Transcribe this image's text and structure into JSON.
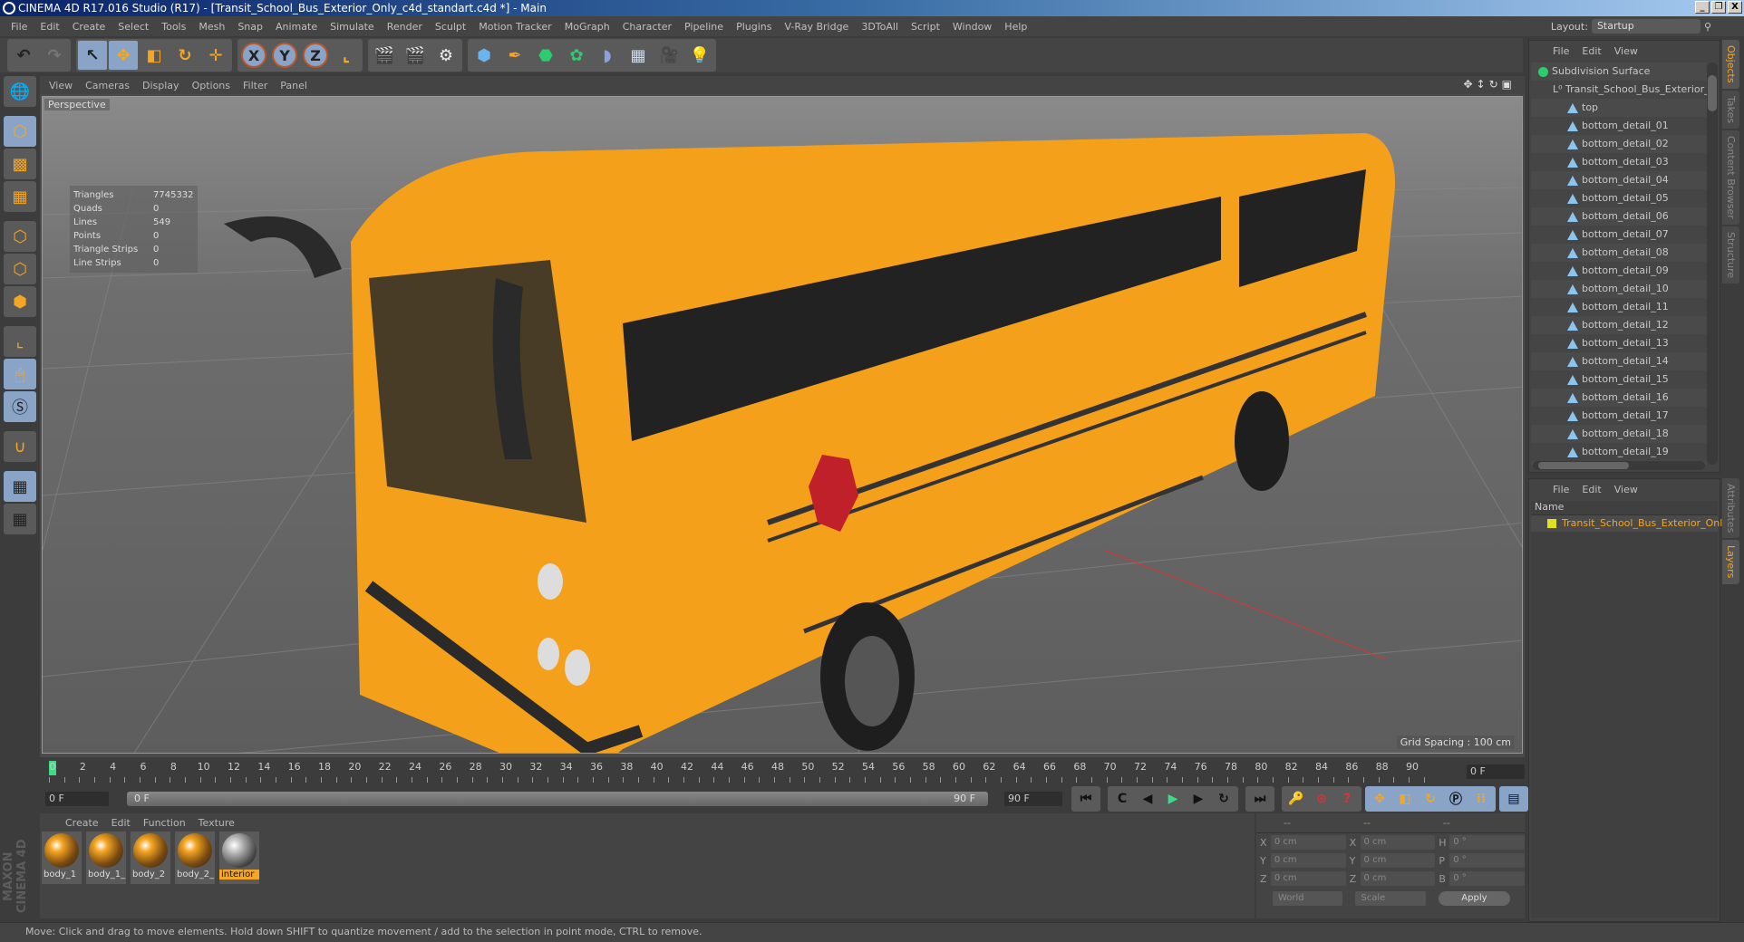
{
  "window": {
    "title": "CINEMA 4D R17.016 Studio (R17) - [Transit_School_Bus_Exterior_Only_c4d_standart.c4d *] - Main",
    "controls": [
      "_",
      "❐",
      "X"
    ]
  },
  "menu": [
    "File",
    "Edit",
    "Create",
    "Select",
    "Tools",
    "Mesh",
    "Snap",
    "Animate",
    "Simulate",
    "Render",
    "Sculpt",
    "Motion Tracker",
    "MoGraph",
    "Character",
    "Pipeline",
    "Plugins",
    "V-Ray Bridge",
    "3DToAll",
    "Script",
    "Window",
    "Help"
  ],
  "layout": {
    "label": "Layout:",
    "value": "Startup"
  },
  "toolbar": {
    "undo": "undo-icon",
    "redo": "redo-icon",
    "tools": [
      {
        "name": "live-selection",
        "glyph": "↖"
      },
      {
        "name": "move",
        "glyph": "✥"
      },
      {
        "name": "scale",
        "glyph": "◧"
      },
      {
        "name": "rotate",
        "glyph": "↻"
      },
      {
        "name": "recent-tool",
        "glyph": "✛"
      }
    ],
    "axes": [
      "X",
      "Y",
      "Z"
    ],
    "coord": "world-coordinate-icon",
    "render": [
      "render-view",
      "render-picture-viewer",
      "edit-render-settings"
    ],
    "objects": [
      "cube",
      "pen-spline",
      "subdivision",
      "cloner",
      "deformer",
      "floor",
      "camera",
      "light"
    ]
  },
  "left_tools": [
    "model-mode",
    "texture-mode",
    "workplane",
    "points-mode",
    "edges-mode",
    "polygons-mode",
    "axis",
    "tweak",
    "solo",
    "snap",
    "lock-workplane",
    "workplane-align"
  ],
  "viewport": {
    "menu": [
      "View",
      "Cameras",
      "Display",
      "Options",
      "Filter",
      "Panel"
    ],
    "camera": "Perspective",
    "stats": [
      {
        "k": "Triangles",
        "v": "7745332"
      },
      {
        "k": "Quads",
        "v": "0"
      },
      {
        "k": "Lines",
        "v": "549"
      },
      {
        "k": "Points",
        "v": "0"
      },
      {
        "k": "Triangle Strips",
        "v": "0"
      },
      {
        "k": "Line Strips",
        "v": "0"
      }
    ],
    "grid": "Grid Spacing : 100 cm",
    "bus_color": "#f5a01a"
  },
  "timeline": {
    "ticks": [
      "0",
      "2",
      "4",
      "6",
      "8",
      "10",
      "12",
      "14",
      "16",
      "18",
      "20",
      "22",
      "24",
      "26",
      "28",
      "30",
      "32",
      "34",
      "36",
      "38",
      "40",
      "42",
      "44",
      "46",
      "48",
      "50",
      "52",
      "54",
      "56",
      "58",
      "60",
      "62",
      "64",
      "66",
      "68",
      "70",
      "72",
      "74",
      "76",
      "78",
      "80",
      "82",
      "84",
      "86",
      "88",
      "90"
    ],
    "current": "0 F",
    "start": "0 F",
    "range_start": "0 F",
    "range_end": "90 F",
    "end": "90 F",
    "current_frame_fraction": 0
  },
  "transport": [
    "⏮",
    "C",
    "◀(",
    "▶",
    ")▶",
    "↻",
    "⏭"
  ],
  "materials": {
    "menu": [
      "Create",
      "Edit",
      "Function",
      "Texture"
    ],
    "items": [
      {
        "label": "body_1",
        "selected": false
      },
      {
        "label": "body_1_",
        "selected": false
      },
      {
        "label": "body_2",
        "selected": false
      },
      {
        "label": "body_2_",
        "selected": false
      },
      {
        "label": "interior",
        "selected": true
      }
    ]
  },
  "brand": "MAXON CINEMA 4D",
  "coords": {
    "headers": [
      "--",
      "--",
      "--"
    ],
    "rows": [
      {
        "a1": "X",
        "v1": "0 cm",
        "a2": "X",
        "v2": "0 cm",
        "a3": "H",
        "v3": "0 °"
      },
      {
        "a1": "Y",
        "v1": "0 cm",
        "a2": "Y",
        "v2": "0 cm",
        "a3": "P",
        "v3": "0 °"
      },
      {
        "a1": "Z",
        "v1": "0 cm",
        "a2": "Z",
        "v2": "0 cm",
        "a3": "B",
        "v3": "0 °"
      }
    ],
    "mode": "World",
    "size": "Scale",
    "apply": "Apply"
  },
  "status": "Move: Click and drag to move elements. Hold down SHIFT to quantize movement / add to the selection in point mode, CTRL to remove.",
  "objects": {
    "menu": [
      "File",
      "Edit",
      "View"
    ],
    "tree": [
      {
        "label": "Subdivision Surface",
        "indent": 0,
        "icon": "subdivision"
      },
      {
        "label": "Transit_School_Bus_Exterior_Only",
        "indent": 1,
        "icon": "null"
      },
      {
        "label": "top",
        "indent": 2,
        "icon": "polygon"
      },
      {
        "label": "bottom_detail_01",
        "indent": 2,
        "icon": "polygon"
      },
      {
        "label": "bottom_detail_02",
        "indent": 2,
        "icon": "polygon"
      },
      {
        "label": "bottom_detail_03",
        "indent": 2,
        "icon": "polygon"
      },
      {
        "label": "bottom_detail_04",
        "indent": 2,
        "icon": "polygon"
      },
      {
        "label": "bottom_detail_05",
        "indent": 2,
        "icon": "polygon"
      },
      {
        "label": "bottom_detail_06",
        "indent": 2,
        "icon": "polygon"
      },
      {
        "label": "bottom_detail_07",
        "indent": 2,
        "icon": "polygon"
      },
      {
        "label": "bottom_detail_08",
        "indent": 2,
        "icon": "polygon"
      },
      {
        "label": "bottom_detail_09",
        "indent": 2,
        "icon": "polygon"
      },
      {
        "label": "bottom_detail_10",
        "indent": 2,
        "icon": "polygon"
      },
      {
        "label": "bottom_detail_11",
        "indent": 2,
        "icon": "polygon"
      },
      {
        "label": "bottom_detail_12",
        "indent": 2,
        "icon": "polygon"
      },
      {
        "label": "bottom_detail_13",
        "indent": 2,
        "icon": "polygon"
      },
      {
        "label": "bottom_detail_14",
        "indent": 2,
        "icon": "polygon"
      },
      {
        "label": "bottom_detail_15",
        "indent": 2,
        "icon": "polygon"
      },
      {
        "label": "bottom_detail_16",
        "indent": 2,
        "icon": "polygon"
      },
      {
        "label": "bottom_detail_17",
        "indent": 2,
        "icon": "polygon"
      },
      {
        "label": "bottom_detail_18",
        "indent": 2,
        "icon": "polygon"
      },
      {
        "label": "bottom_detail_19",
        "indent": 2,
        "icon": "polygon"
      }
    ],
    "side_tabs": [
      {
        "label": "Objects",
        "active": true
      },
      {
        "label": "Takes",
        "active": false
      },
      {
        "label": "Content Browser",
        "active": false
      },
      {
        "label": "Structure",
        "active": false
      }
    ]
  },
  "layers": {
    "menu": [
      "File",
      "Edit",
      "View"
    ],
    "header": "Name",
    "items": [
      {
        "label": "Transit_School_Bus_Exterior_Only",
        "color": "#e0e020"
      }
    ],
    "side_tabs": [
      {
        "label": "Attributes",
        "active": false
      },
      {
        "label": "Layers",
        "active": true
      }
    ]
  }
}
